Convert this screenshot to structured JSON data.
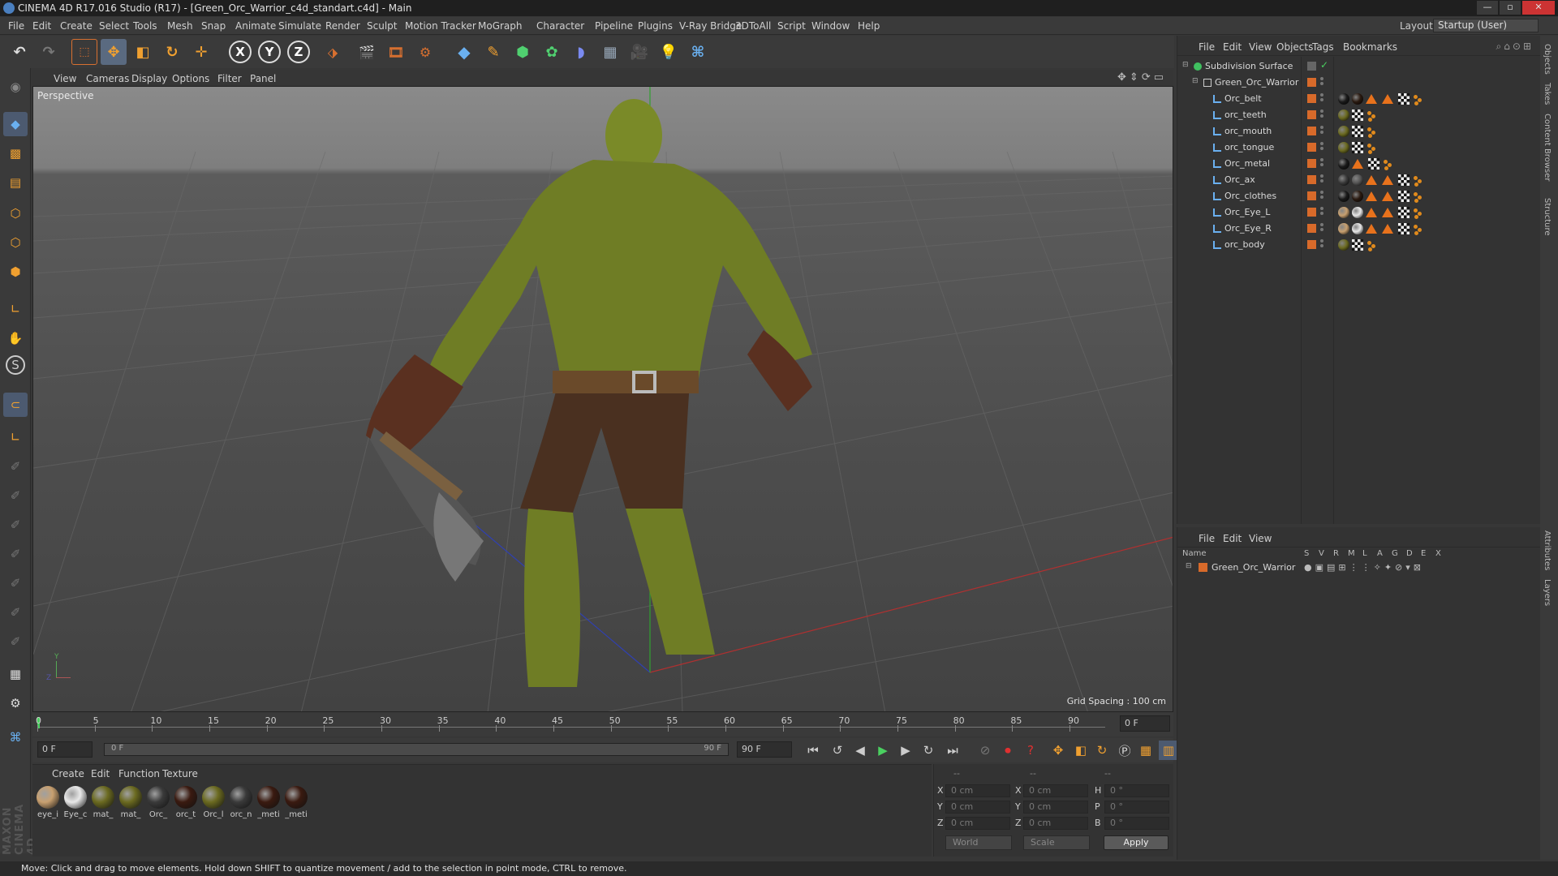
{
  "window": {
    "title": "CINEMA 4D R17.016 Studio (R17) - [Green_Orc_Warrior_c4d_standart.c4d] - Main"
  },
  "menu": [
    "File",
    "Edit",
    "Create",
    "Select",
    "Tools",
    "Mesh",
    "Snap",
    "Animate",
    "Simulate",
    "Render",
    "Sculpt",
    "Motion Tracker",
    "MoGraph",
    "Character",
    "Pipeline",
    "Plugins",
    "V-Ray Bridge",
    "3DToAll",
    "Script",
    "Window",
    "Help"
  ],
  "layout": {
    "label": "Layout:",
    "value": "Startup (User)"
  },
  "toolbar": {
    "x_label": "X",
    "y_label": "Y",
    "z_label": "Z"
  },
  "viewport": {
    "menu": [
      "View",
      "Cameras",
      "Display",
      "Options",
      "Filter",
      "Panel"
    ],
    "label": "Perspective",
    "grid_spacing": "Grid Spacing : 100 cm",
    "axis_y": "Y",
    "axis_z": "Z"
  },
  "timeline": {
    "ticks": [
      "0",
      "5",
      "10",
      "15",
      "20",
      "25",
      "30",
      "35",
      "40",
      "45",
      "50",
      "55",
      "60",
      "65",
      "70",
      "75",
      "80",
      "85",
      "90"
    ],
    "current_frame": "0 F"
  },
  "transport": {
    "start": "0 F",
    "slider_left": "0 F",
    "slider_right": "90 F",
    "end": "90 F"
  },
  "materials": {
    "menu": [
      "Create",
      "Edit",
      "Function",
      "Texture"
    ],
    "items": [
      {
        "label": "eye_i",
        "color": "#c8a070"
      },
      {
        "label": "Eye_c",
        "color": "#e8e8e8"
      },
      {
        "label": "mat_",
        "color": "#6b6a20"
      },
      {
        "label": "mat_",
        "color": "#6b6a20"
      },
      {
        "label": "Orc_",
        "color": "#3a3a3a"
      },
      {
        "label": "orc_t",
        "color": "#3a1a10"
      },
      {
        "label": "Orc_l",
        "color": "#6b6a20"
      },
      {
        "label": "orc_n",
        "color": "#3a3a3a"
      },
      {
        "label": "_meti",
        "color": "#3a1a10"
      },
      {
        "label": "_meti",
        "color": "#3a1a10"
      }
    ]
  },
  "coords": {
    "headers": [
      "--",
      "--",
      "--"
    ],
    "rows": [
      {
        "a": "X",
        "av": "0 cm",
        "b": "X",
        "bv": "0 cm",
        "c": "H",
        "cv": "0 °"
      },
      {
        "a": "Y",
        "av": "0 cm",
        "b": "Y",
        "bv": "0 cm",
        "c": "P",
        "cv": "0 °"
      },
      {
        "a": "Z",
        "av": "0 cm",
        "b": "Z",
        "bv": "0 cm",
        "c": "B",
        "cv": "0 °"
      }
    ],
    "world": "World",
    "scale": "Scale",
    "apply": "Apply"
  },
  "status": "Move: Click and drag to move elements. Hold down SHIFT to quantize movement / add to the selection in point mode, CTRL to remove.",
  "object_manager": {
    "menu": [
      "File",
      "Edit",
      "View",
      "Objects",
      "Tags",
      "Bookmarks"
    ],
    "root": "Subdivision Surface",
    "group": "Green_Orc_Warrior",
    "objects": [
      {
        "name": "Orc_belt",
        "tags": [
          "ball:#1a1a1a",
          "ball:#2a1a10",
          "tri",
          "tri",
          "chk",
          "dts"
        ]
      },
      {
        "name": "orc_teeth",
        "tags": [
          "ball:#6b6a20",
          "chk",
          "dts"
        ]
      },
      {
        "name": "orc_mouth",
        "tags": [
          "ball:#6b6a20",
          "chk",
          "dts"
        ]
      },
      {
        "name": "orc_tongue",
        "tags": [
          "ball:#6b6a20",
          "chk",
          "dts"
        ]
      },
      {
        "name": "Orc_metal",
        "tags": [
          "ball:#1a1a1a",
          "tri",
          "chk",
          "dts"
        ]
      },
      {
        "name": "Orc_ax",
        "tags": [
          "ball:#3a3a3a",
          "ball:#555555",
          "tri",
          "tri",
          "chk",
          "dts"
        ]
      },
      {
        "name": "Orc_clothes",
        "tags": [
          "ball:#1a1a1a",
          "ball:#2a1a10",
          "tri",
          "tri",
          "chk",
          "dts"
        ]
      },
      {
        "name": "Orc_Eye_L",
        "tags": [
          "ball:#c8a070",
          "ball:#e8e8e8",
          "tri",
          "tri",
          "chk",
          "dts"
        ]
      },
      {
        "name": "Orc_Eye_R",
        "tags": [
          "ball:#c8a070",
          "ball:#e8e8e8",
          "tri",
          "tri",
          "chk",
          "dts"
        ]
      },
      {
        "name": "orc_body",
        "tags": [
          "ball:#6b6a20",
          "chk",
          "dts"
        ]
      }
    ]
  },
  "layer_manager": {
    "menu": [
      "File",
      "Edit",
      "View"
    ],
    "columns": [
      "Name",
      "S",
      "V",
      "R",
      "M",
      "L",
      "A",
      "G",
      "D",
      "E",
      "X"
    ],
    "layers": [
      {
        "name": "Green_Orc_Warrior",
        "color": "#d86a2a"
      }
    ]
  },
  "right_tabs": [
    "Objects",
    "Takes",
    "Content Browser",
    "Structure",
    "Attributes",
    "Layers"
  ],
  "branding": "MAXON CINEMA 4D"
}
